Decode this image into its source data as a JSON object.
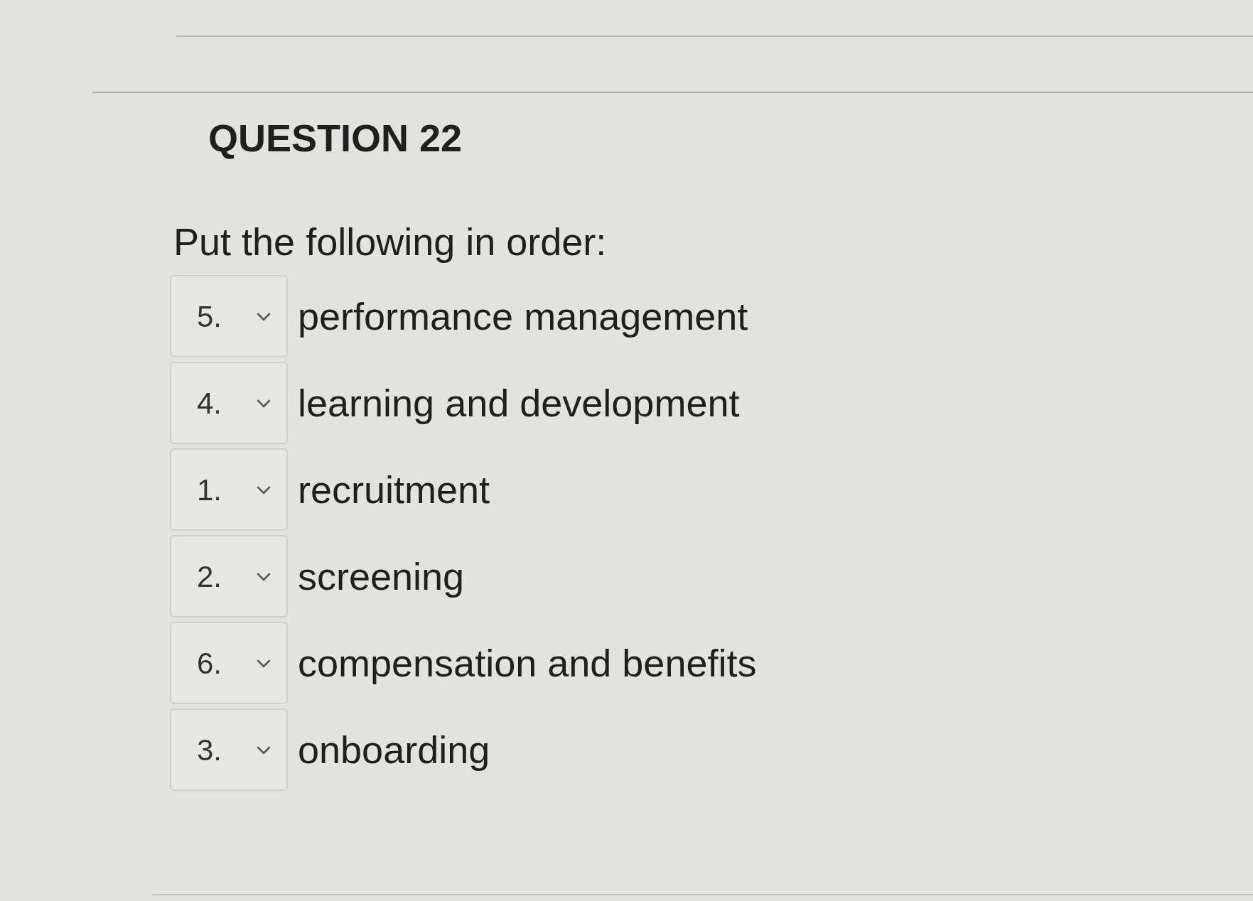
{
  "question": {
    "title": "QUESTION 22",
    "prompt": "Put the following in order:",
    "items": [
      {
        "choice": "5.",
        "text": "performance management"
      },
      {
        "choice": "4.",
        "text": "learning and development"
      },
      {
        "choice": "1.",
        "text": "recruitment"
      },
      {
        "choice": "2.",
        "text": "screening"
      },
      {
        "choice": "6.",
        "text": "compensation and benefits"
      },
      {
        "choice": "3.",
        "text": "onboarding"
      }
    ]
  }
}
